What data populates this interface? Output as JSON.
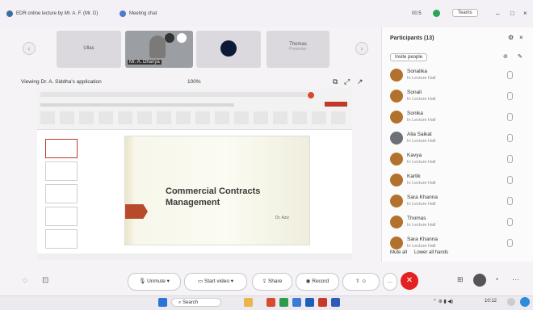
{
  "window": {
    "title": "EDR online lecture by Mr. A. F. (Mr. D)",
    "tab": "Meeting chat",
    "time": "00:5",
    "account": "Teams"
  },
  "video_tiles": [
    {
      "label": "Ullas"
    },
    {
      "label": "Mr. A. Dhanya"
    },
    {
      "label": ""
    },
    {
      "label": "Thomas",
      "sub": "Presenter"
    }
  ],
  "share": {
    "title": "Viewing Dr. A. Siddha's application",
    "zoom": "100%"
  },
  "slide": {
    "title_line1": "Commercial Contracts",
    "title_line2": "Management",
    "footer": "Dr. Aziz"
  },
  "participants": {
    "header": "Participants (13)",
    "invite": "Invite people",
    "items": [
      {
        "name": "Sonalika",
        "sub": "In Lecture Hall"
      },
      {
        "name": "Sonali",
        "sub": "In Lecture Hall"
      },
      {
        "name": "Sonika",
        "sub": "In Lecture Hall"
      },
      {
        "name": "Alia Saikat",
        "sub": "In Lecture Hall"
      },
      {
        "name": "Kavya",
        "sub": "In Lecture Hall"
      },
      {
        "name": "Kartik",
        "sub": "In Lecture Hall"
      },
      {
        "name": "Sara Khanna",
        "sub": "In Lecture Hall"
      },
      {
        "name": "Thomas",
        "sub": "In Lecture Hall"
      },
      {
        "name": "Sara Khanna",
        "sub": "In Lecture Hall"
      }
    ],
    "mute_all": "Mute all",
    "lower_hands": "Lower all hands"
  },
  "controls": {
    "unmute": "Unmute",
    "start_video": "Start video",
    "share": "Share",
    "record": "Record",
    "more": "More"
  },
  "taskbar": {
    "search": "Search",
    "clock": "10:12"
  },
  "colors": {
    "accent": "#b3712e",
    "leave": "#e32121",
    "slide_arrow": "#b84a2a"
  }
}
